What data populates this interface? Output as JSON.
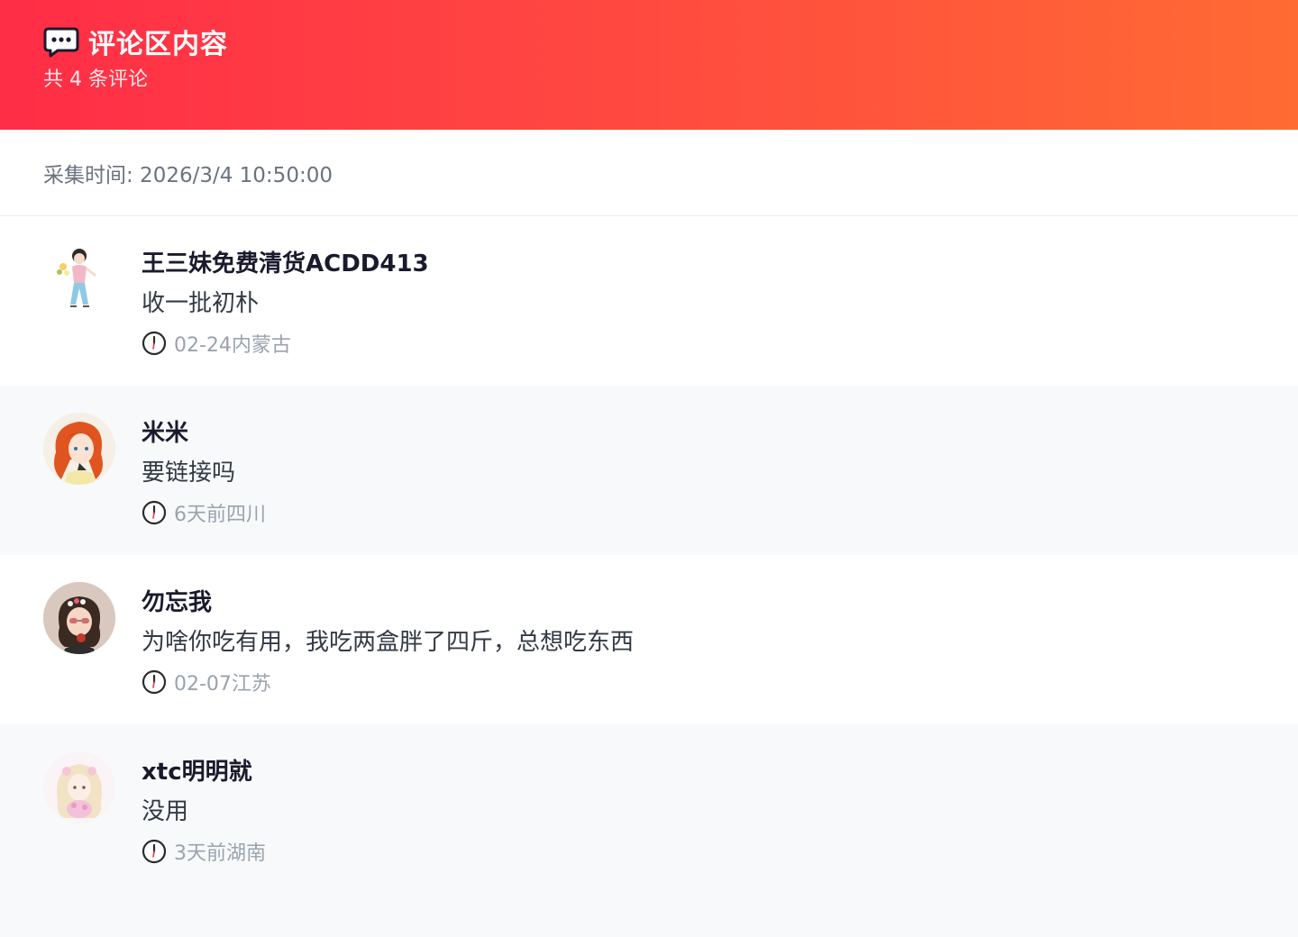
{
  "header": {
    "icon": "speech-bubble-icon",
    "title": "评论区内容",
    "subtitle": "共 4 条评论"
  },
  "meta": {
    "collect_time": "采集时间: 2026/3/4 10:50:00"
  },
  "comments": [
    {
      "name": "王三妹免费清货ACDD413",
      "text": "收一批初朴",
      "time_location": "02-24内蒙古",
      "avatar": "avatar-girl-with-flowers"
    },
    {
      "name": "米米",
      "text": "要链接吗",
      "time_location": "6天前四川",
      "avatar": "avatar-red-haired-girl"
    },
    {
      "name": "勿忘我",
      "text": "为啥你吃有用，我吃两盒胖了四斤，总想吃东西",
      "time_location": "02-07江苏",
      "avatar": "avatar-girl-with-sunglasses"
    },
    {
      "name": "xtc明明就",
      "text": "没用",
      "time_location": "3天前湖南",
      "avatar": "avatar-blonde-girl-pink"
    }
  ],
  "colors": {
    "header_gradient_start": "#ff2d47",
    "header_gradient_end": "#ff6b33",
    "alt_row_bg": "#f8f9fa"
  }
}
